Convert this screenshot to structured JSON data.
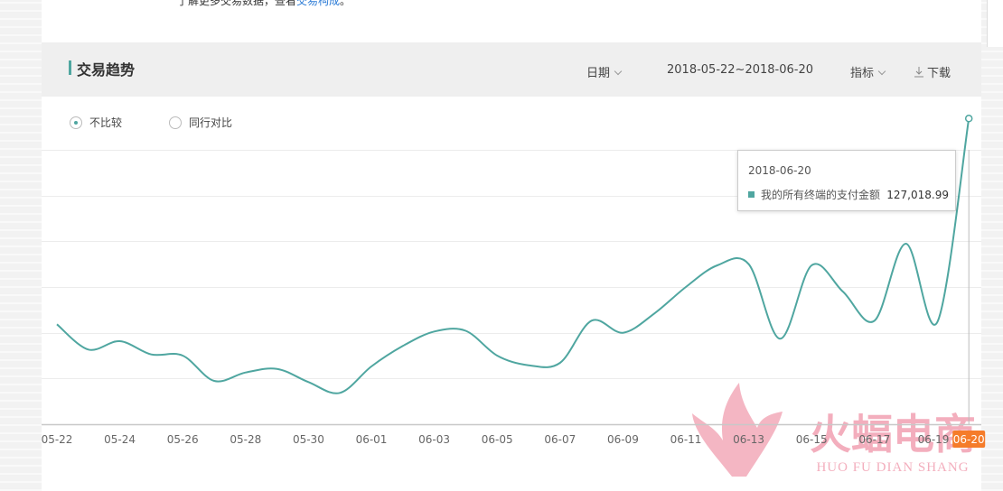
{
  "notice": {
    "text": "了解更多交易数据，查看",
    "link": "交易构成",
    "end": "。"
  },
  "header": {
    "title": "交易趋势",
    "date_menu": "日期",
    "date_range": "2018-05-22~2018-06-20",
    "metric_menu": "指标",
    "download": "下载"
  },
  "compare": {
    "option_none": "不比较",
    "option_peer": "同行对比",
    "selected": "不比较"
  },
  "tooltip": {
    "date": "2018-06-20",
    "series_label": "我的所有终端的支付金额",
    "value": "127,018.99"
  },
  "watermark": {
    "cn": "火蝠电商",
    "en": "HUO FU DIAN SHANG"
  },
  "colors": {
    "line": "#4fa6a0",
    "accent_badge": "#f57c2a",
    "watermark": "#f3aebd"
  },
  "chart_data": {
    "type": "line",
    "x_tick_labels": [
      "05-22",
      "05-24",
      "05-26",
      "05-28",
      "05-30",
      "06-01",
      "06-03",
      "06-05",
      "06-07",
      "06-09",
      "06-11",
      "06-13",
      "06-15",
      "06-17",
      "06-19",
      "06-20"
    ],
    "highlighted_x": "06-20",
    "y_axis_labels_visible": false,
    "grid": "horizontal",
    "ylim": [
      0,
      150000
    ],
    "series": [
      {
        "x": [
          "05-22",
          "05-23",
          "05-24",
          "05-25",
          "05-26",
          "05-27",
          "05-28",
          "05-29",
          "05-30",
          "05-31",
          "06-01",
          "06-02",
          "06-03",
          "06-04",
          "06-05",
          "06-06",
          "06-07",
          "06-08",
          "06-09",
          "06-10",
          "06-11",
          "06-12",
          "06-13",
          "06-14",
          "06-15",
          "06-16",
          "06-17",
          "06-18",
          "06-19",
          "06-20"
        ],
        "values": [
          41500,
          31000,
          34500,
          29000,
          28500,
          18000,
          21500,
          23000,
          17500,
          13000,
          24000,
          32500,
          38500,
          38800,
          28500,
          24500,
          25500,
          43000,
          38000,
          46000,
          57000,
          66000,
          66500,
          35500,
          66000,
          55000,
          43000,
          75000,
          42500,
          127019
        ]
      }
    ]
  }
}
